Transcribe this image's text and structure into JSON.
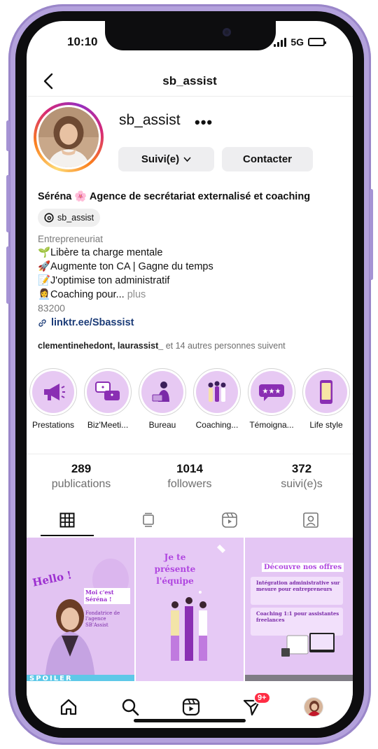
{
  "status_bar": {
    "time": "10:10",
    "network": "5G"
  },
  "header": {
    "title": "sb_assist"
  },
  "profile": {
    "username": "sb_assist",
    "more": "•••",
    "follow_button": "Suivi(e)",
    "contact_button": "Contacter",
    "bio_name": "Séréna 🌸 Agence de secrétariat externalisé et coaching",
    "threads_handle": "sb_assist",
    "category": "Entrepreneuriat",
    "bio_lines": [
      "🌱Libère ta charge mentale",
      "🚀Augmente ton CA | Gagne du temps",
      "📝J'optimise ton administratif",
      "👩‍💼Coaching pour..."
    ],
    "bio_more": "plus",
    "zip": "83200",
    "link": "linktr.ee/Sbassist",
    "followed_by_names": "clementinehedont, laurassist_",
    "followed_by_rest": " et 14 autres personnes suivent"
  },
  "highlights": [
    {
      "label": "Prestations",
      "icon": "megaphone-icon"
    },
    {
      "label": "Biz'Meeti...",
      "icon": "chat-bubbles-icon"
    },
    {
      "label": "Bureau",
      "icon": "woman-laptop-icon"
    },
    {
      "label": "Coaching...",
      "icon": "women-group-icon"
    },
    {
      "label": "Témoigna...",
      "icon": "stars-review-icon"
    },
    {
      "label": "Life style",
      "icon": "smartphone-icon"
    }
  ],
  "stats": {
    "posts": {
      "value": "289",
      "label": "publications"
    },
    "followers": {
      "value": "1014",
      "label": "followers"
    },
    "following": {
      "value": "372",
      "label": "suivi(e)s"
    }
  },
  "tabs": [
    "grid-icon",
    "reels-feed-icon",
    "reels-icon",
    "tagged-icon"
  ],
  "posts": [
    {
      "title": "Hello !",
      "subtitle": "Moi c'est Séréna !",
      "caption": "Fondatrice de l'agence SB'Assist",
      "footer": "SPOILER"
    },
    {
      "title": "Je te présente l'équipe"
    },
    {
      "title": "Découvre nos offres",
      "items": [
        "Intégration administrative sur mesure pour entrepreneurs",
        "Coaching 1:1 pour assistantes freelances"
      ]
    }
  ],
  "bottom_nav": {
    "notification_badge": "9+"
  },
  "colors": {
    "accent_link": "#1c3c78",
    "highlight_fill": "#e7c9f3",
    "post_purple": "#e8cdf5",
    "badge_red": "#ff2d44"
  }
}
